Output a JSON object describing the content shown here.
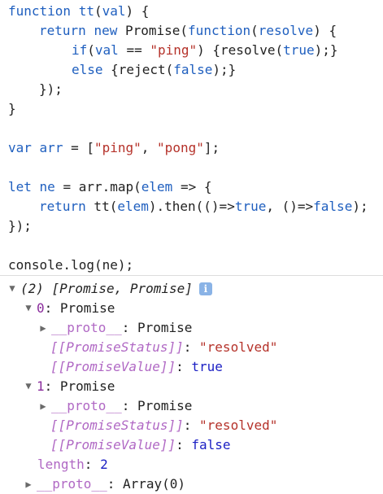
{
  "code_lines": [
    {
      "segments": [
        {
          "t": "function",
          "c": "kw"
        },
        {
          "t": " ",
          "c": "plain"
        },
        {
          "t": "tt",
          "c": "kw"
        },
        {
          "t": "(",
          "c": "plain"
        },
        {
          "t": "val",
          "c": "kw"
        },
        {
          "t": ") {",
          "c": "plain"
        }
      ]
    },
    {
      "segments": [
        {
          "t": "return",
          "c": "kw"
        },
        {
          "t": " ",
          "c": "plain"
        },
        {
          "t": "new",
          "c": "kw"
        },
        {
          "t": " Promise(",
          "c": "plain"
        },
        {
          "t": "function",
          "c": "kw"
        },
        {
          "t": "(",
          "c": "plain"
        },
        {
          "t": "resolve",
          "c": "kw"
        },
        {
          "t": ") {",
          "c": "plain"
        }
      ]
    },
    {
      "segments": [
        {
          "t": "if",
          "c": "kw"
        },
        {
          "t": "(",
          "c": "plain"
        },
        {
          "t": "val",
          "c": "kw"
        },
        {
          "t": " == ",
          "c": "plain"
        },
        {
          "t": "\"ping\"",
          "c": "str"
        },
        {
          "t": ") {resolve(",
          "c": "plain"
        },
        {
          "t": "true",
          "c": "kw"
        },
        {
          "t": ");}",
          "c": "plain"
        }
      ]
    },
    {
      "segments": [
        {
          "t": "else",
          "c": "kw"
        },
        {
          "t": " {reject(",
          "c": "plain"
        },
        {
          "t": "false",
          "c": "kw"
        },
        {
          "t": ");}",
          "c": "plain"
        }
      ]
    },
    {
      "segments": [
        {
          "t": "});",
          "c": "plain"
        }
      ]
    },
    {
      "segments": [
        {
          "t": "}",
          "c": "plain"
        }
      ]
    },
    {
      "segments": []
    },
    {
      "segments": [
        {
          "t": "var",
          "c": "kw"
        },
        {
          "t": " ",
          "c": "plain"
        },
        {
          "t": "arr",
          "c": "kw"
        },
        {
          "t": " = [",
          "c": "plain"
        },
        {
          "t": "\"ping\"",
          "c": "str"
        },
        {
          "t": ", ",
          "c": "plain"
        },
        {
          "t": "\"pong\"",
          "c": "str"
        },
        {
          "t": "];",
          "c": "plain"
        }
      ]
    },
    {
      "segments": []
    },
    {
      "segments": [
        {
          "t": "let",
          "c": "kw"
        },
        {
          "t": " ",
          "c": "plain"
        },
        {
          "t": "ne",
          "c": "kw"
        },
        {
          "t": " = arr.map(",
          "c": "plain"
        },
        {
          "t": "elem",
          "c": "kw"
        },
        {
          "t": " => {",
          "c": "plain"
        }
      ]
    },
    {
      "segments": [
        {
          "t": "return",
          "c": "kw"
        },
        {
          "t": " tt(",
          "c": "plain"
        },
        {
          "t": "elem",
          "c": "kw"
        },
        {
          "t": ").then(()=>",
          "c": "plain"
        },
        {
          "t": "true",
          "c": "kw"
        },
        {
          "t": ", ()=>",
          "c": "plain"
        },
        {
          "t": "false",
          "c": "kw"
        },
        {
          "t": ");",
          "c": "plain"
        }
      ]
    },
    {
      "segments": [
        {
          "t": "});",
          "c": "plain"
        }
      ]
    },
    {
      "segments": []
    },
    {
      "segments": [
        {
          "t": "console.log(ne);",
          "c": "plain"
        }
      ]
    }
  ],
  "console": {
    "root_label": "(2) [Promise, Promise]",
    "info_glyph": "i",
    "items": [
      {
        "index": "0",
        "type": "Promise",
        "proto_key": "__proto__",
        "proto_value": "Promise",
        "status_key": "[[PromiseStatus]]",
        "status_value": "\"resolved\"",
        "value_key": "[[PromiseValue]]",
        "value_value": "true"
      },
      {
        "index": "1",
        "type": "Promise",
        "proto_key": "__proto__",
        "proto_value": "Promise",
        "status_key": "[[PromiseStatus]]",
        "status_value": "\"resolved\"",
        "value_key": "[[PromiseValue]]",
        "value_value": "false"
      }
    ],
    "length_key": "length",
    "length_value": "2",
    "array_proto_key": "__proto__",
    "array_proto_value": "Array(0)"
  }
}
